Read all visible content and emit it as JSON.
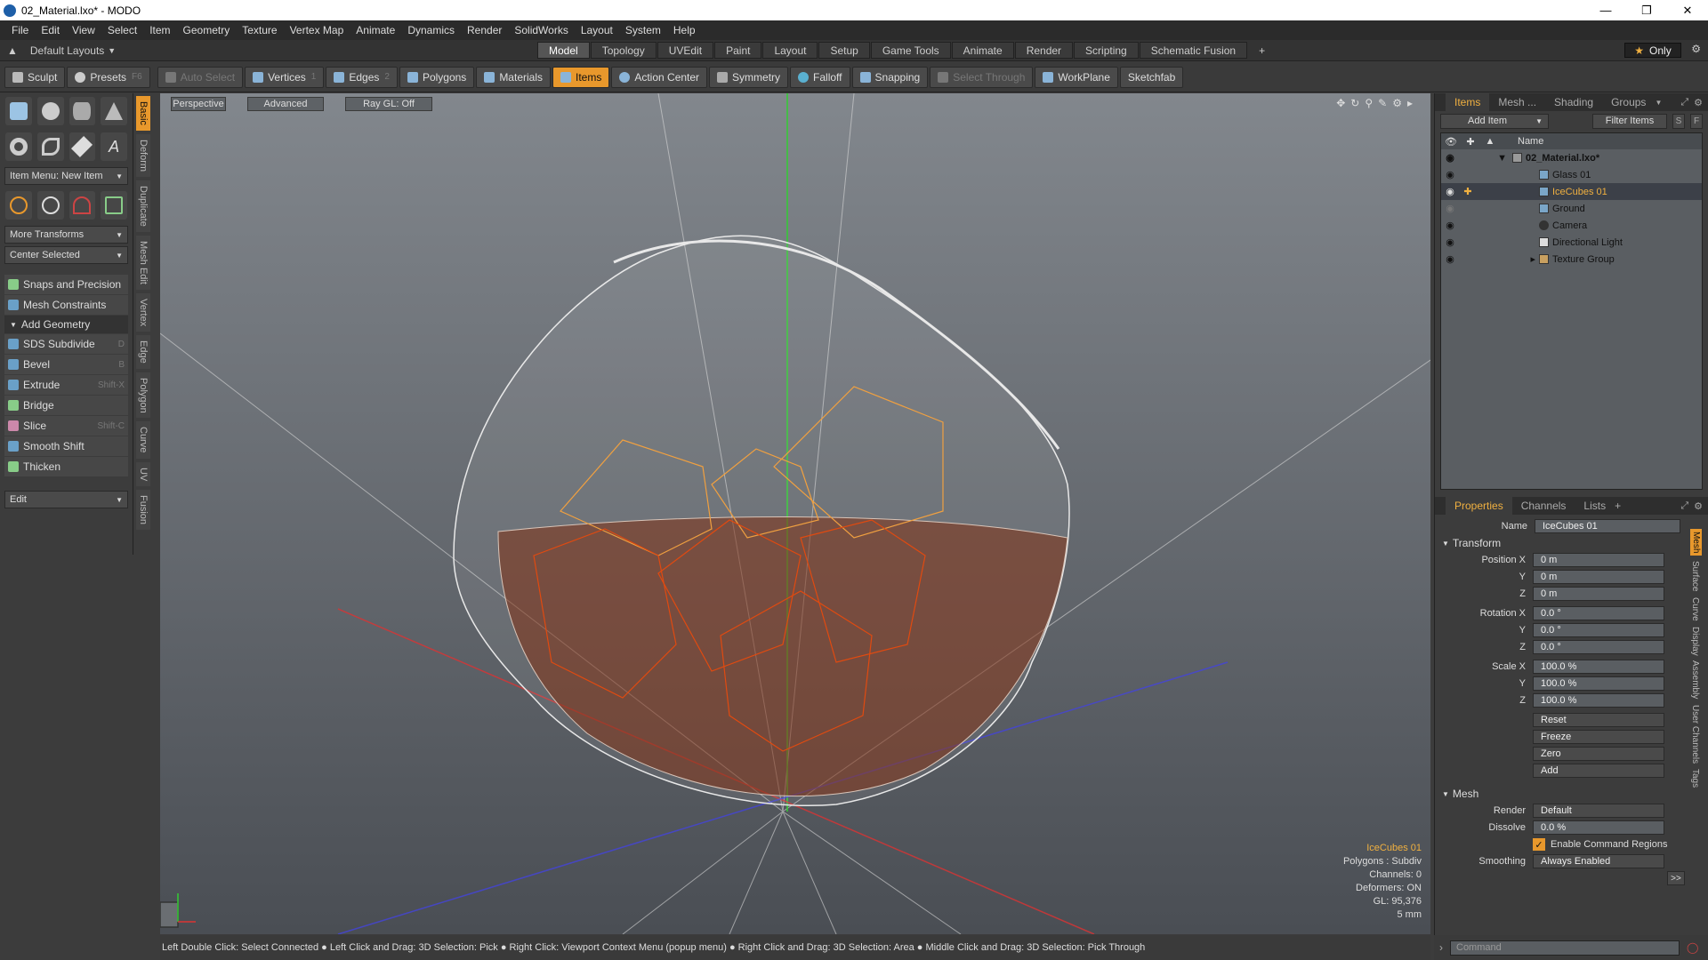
{
  "window": {
    "title": "02_Material.lxo* - MODO"
  },
  "menu": [
    "File",
    "Edit",
    "View",
    "Select",
    "Item",
    "Geometry",
    "Texture",
    "Vertex Map",
    "Animate",
    "Dynamics",
    "Render",
    "SolidWorks",
    "Layout",
    "System",
    "Help"
  ],
  "layout": {
    "preset": "Default Layouts",
    "tabs": [
      "Model",
      "Topology",
      "UVEdit",
      "Paint",
      "Layout",
      "Setup",
      "Game Tools",
      "Animate",
      "Render",
      "Scripting",
      "Schematic Fusion"
    ],
    "active_tab": "Model",
    "only_label": "Only"
  },
  "toolbar": {
    "sculpt": "Sculpt",
    "presets": "Presets",
    "presets_key": "F6",
    "auto_select": "Auto Select",
    "vertices": "Vertices",
    "vertices_count": "1",
    "edges": "Edges",
    "edges_count": "2",
    "polygons": "Polygons",
    "materials": "Materials",
    "items": "Items",
    "action_center": "Action Center",
    "symmetry": "Symmetry",
    "falloff": "Falloff",
    "snapping": "Snapping",
    "select_through": "Select Through",
    "workplane": "WorkPlane",
    "sketchfab": "Sketchfab"
  },
  "left_panel": {
    "item_menu": "Item Menu: New Item",
    "more_transforms": "More Transforms",
    "center_selected": "Center Selected",
    "snaps": "Snaps and Precision",
    "mesh_constraints": "Mesh Constraints",
    "add_geometry": "Add Geometry",
    "tools": [
      {
        "label": "SDS Subdivide",
        "key": "D"
      },
      {
        "label": "Bevel",
        "key": "B"
      },
      {
        "label": "Extrude",
        "key": "Shift-X"
      },
      {
        "label": "Bridge",
        "key": ""
      },
      {
        "label": "Slice",
        "key": "Shift-C"
      },
      {
        "label": "Smooth Shift",
        "key": ""
      },
      {
        "label": "Thicken",
        "key": ""
      }
    ],
    "edit": "Edit",
    "vtabs": [
      "Basic",
      "Deform",
      "Duplicate",
      "Mesh Edit",
      "Vertex",
      "Edge",
      "Polygon",
      "Curve",
      "UV",
      "Fusion"
    ]
  },
  "viewport": {
    "perspective": "Perspective",
    "advanced": "Advanced",
    "raygl": "Ray GL: Off",
    "info": {
      "name": "IceCubes 01",
      "polygons": "Polygons : Subdiv",
      "channels": "Channels: 0",
      "deformers": "Deformers: ON",
      "gl": "GL: 95,376",
      "scale": "5 mm"
    }
  },
  "status_hint": "Left Double Click: Select Connected ● Left Click and Drag: 3D Selection: Pick ● Right Click: Viewport Context Menu (popup menu) ● Right Click and Drag: 3D Selection: Area ● Middle Click and Drag: 3D Selection: Pick Through",
  "items_panel": {
    "tabs": [
      "Items",
      "Mesh ...",
      "Shading",
      "Groups"
    ],
    "add_item": "Add Item",
    "filter_items": "Filter Items",
    "s": "S",
    "f": "F",
    "name_col": "Name",
    "rows": [
      {
        "label": "02_Material.lxo*"
      },
      {
        "label": "Glass 01"
      },
      {
        "label": "IceCubes 01"
      },
      {
        "label": "Ground"
      },
      {
        "label": "Camera"
      },
      {
        "label": "Directional Light"
      },
      {
        "label": "Texture Group"
      }
    ]
  },
  "properties": {
    "tabs": [
      "Properties",
      "Channels",
      "Lists"
    ],
    "name_label": "Name",
    "name_value": "IceCubes 01",
    "transform": "Transform",
    "position_label": "Position X",
    "rotation_label": "Rotation X",
    "scale_label": "Scale X",
    "y": "Y",
    "z": "Z",
    "position": [
      "0 m",
      "0 m",
      "0 m"
    ],
    "rotation": [
      "0.0 °",
      "0.0 °",
      "0.0 °"
    ],
    "scale": [
      "100.0 %",
      "100.0 %",
      "100.0 %"
    ],
    "actions": [
      "Reset",
      "Freeze",
      "Zero",
      "Add"
    ],
    "mesh": "Mesh",
    "render_label": "Render",
    "render_value": "Default",
    "dissolve_label": "Dissolve",
    "dissolve_value": "0.0 %",
    "enable_cmd": "Enable Command Regions",
    "smoothing_label": "Smoothing",
    "smoothing_value": "Always Enabled",
    "more": ">>",
    "vtabs": [
      "Mesh",
      "Surface",
      "Curve",
      "Display",
      "Assembly",
      "User Channels",
      "Tags"
    ]
  },
  "command": {
    "placeholder": "Command"
  }
}
